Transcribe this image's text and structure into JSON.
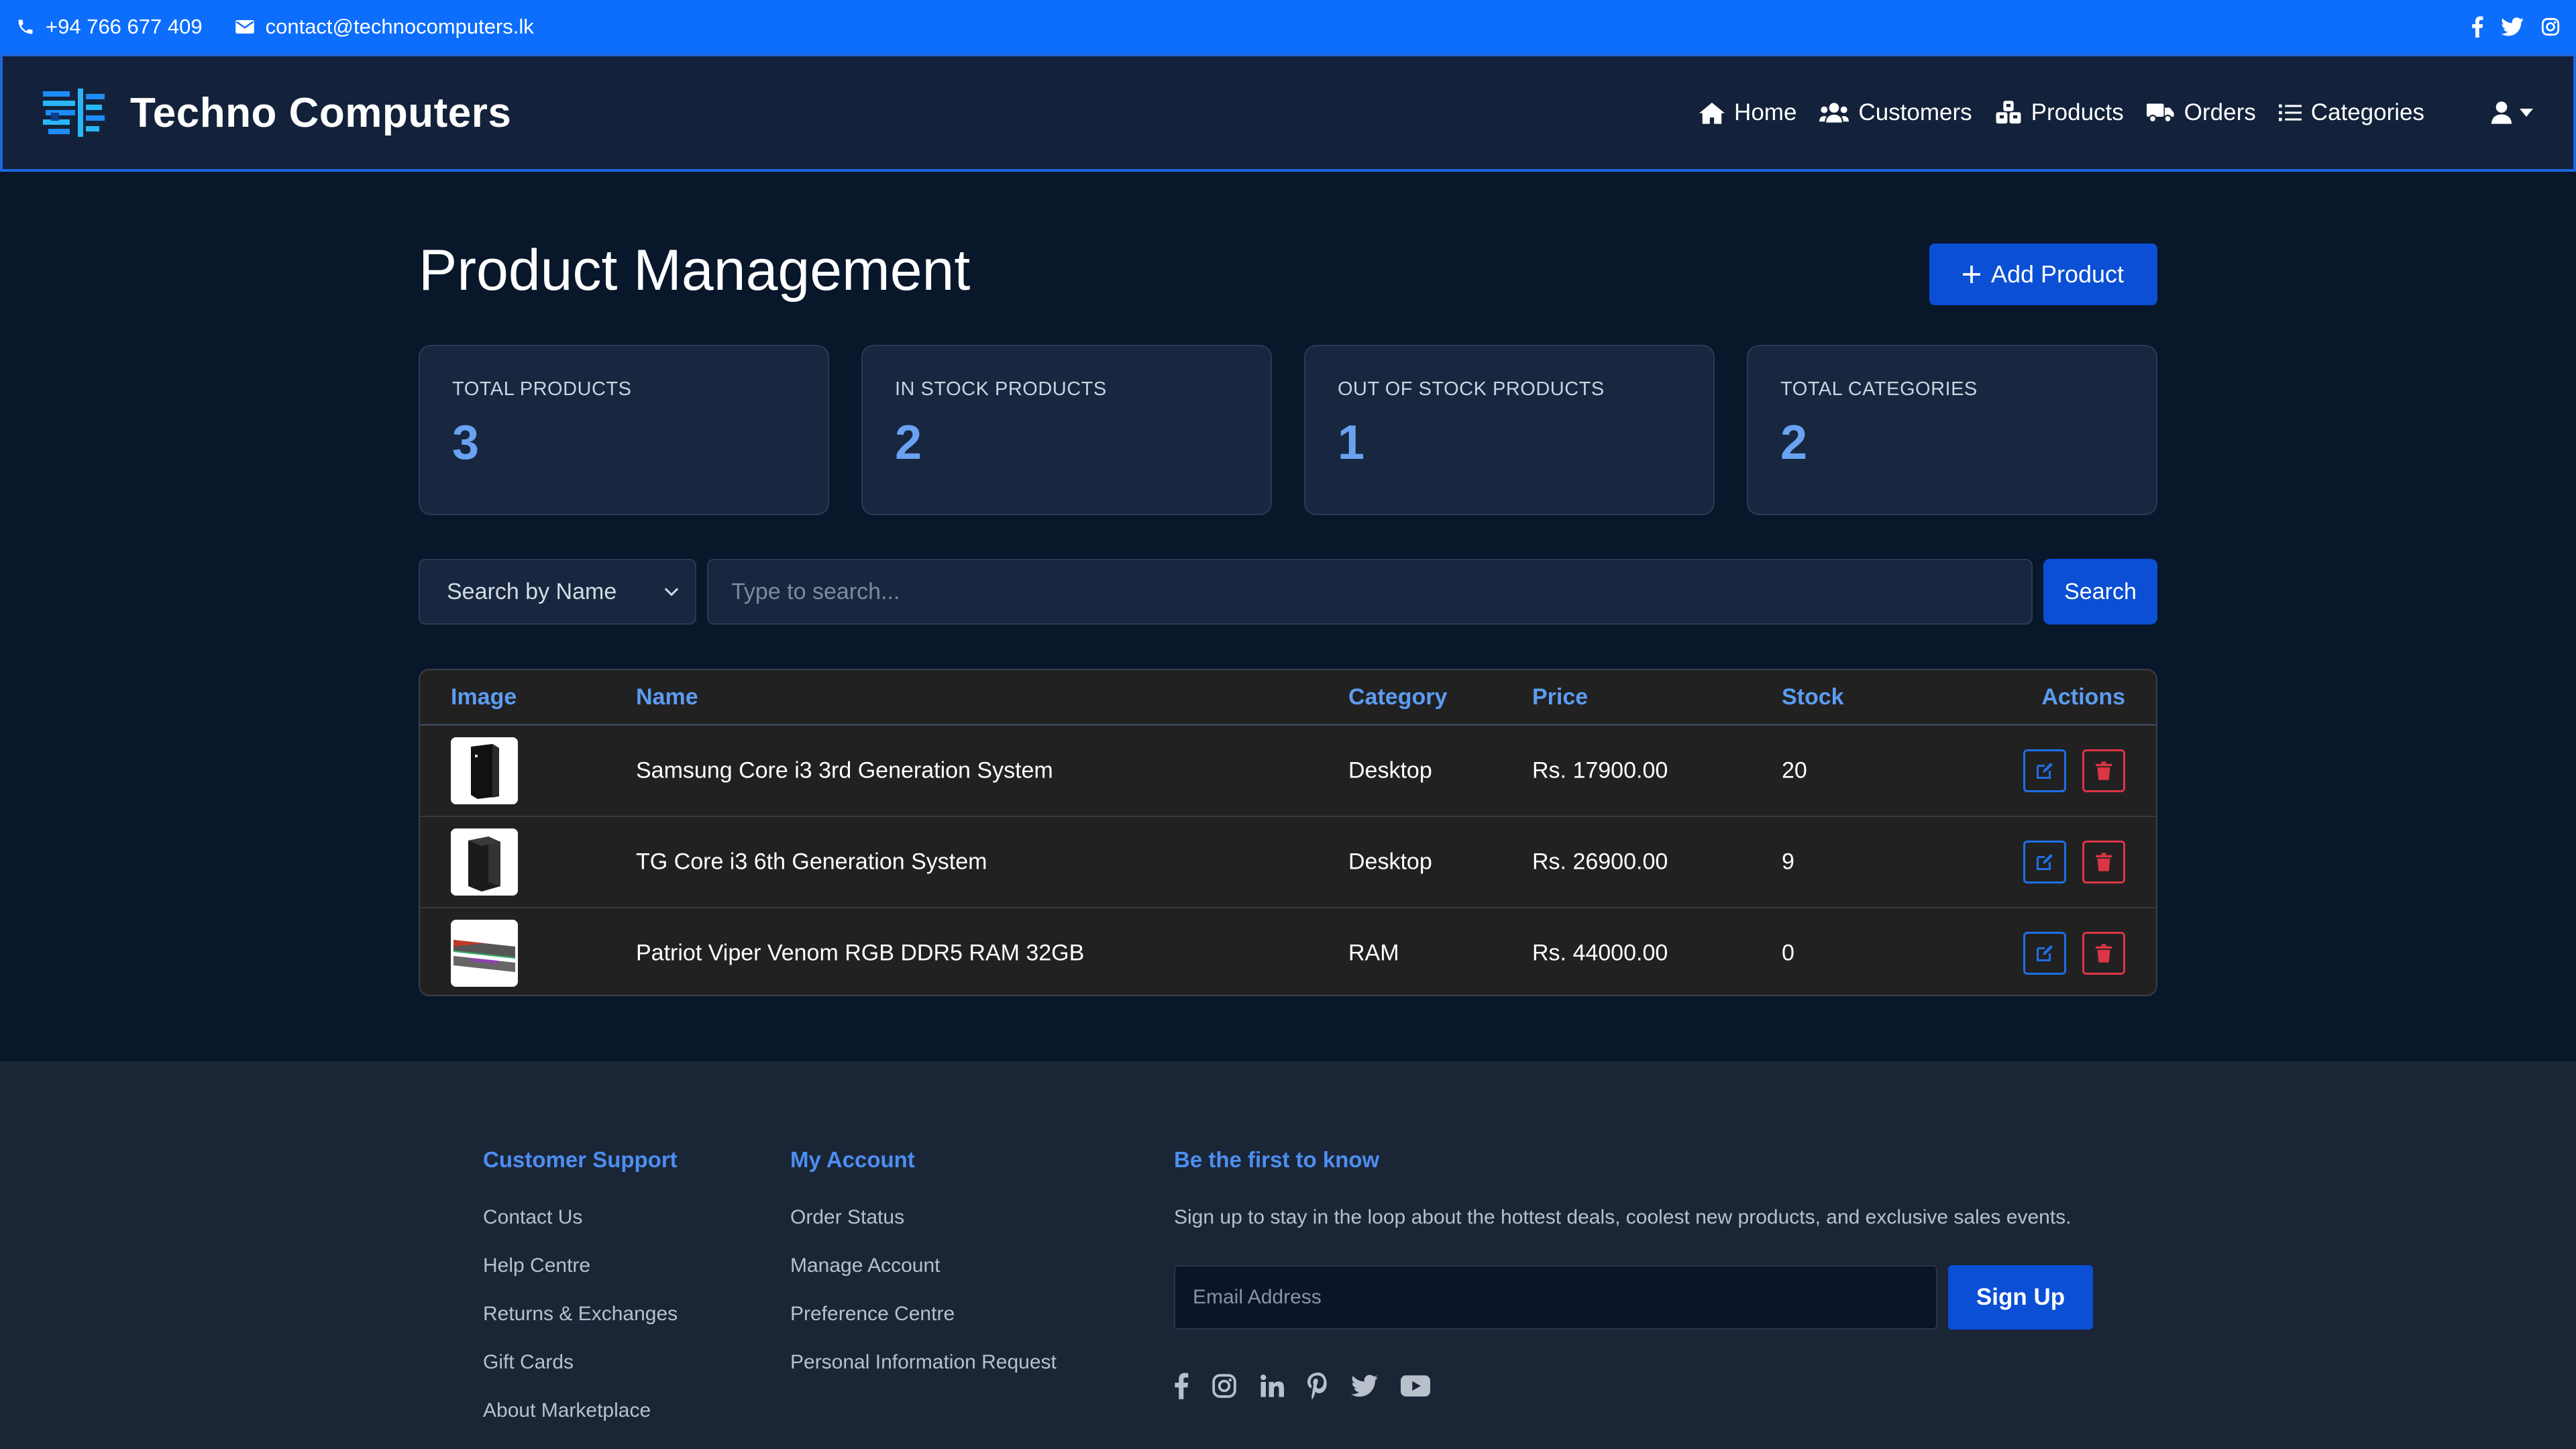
{
  "topbar": {
    "phone": "+94 766 677 409",
    "email": "contact@technocomputers.lk",
    "social_icons": [
      "facebook-icon",
      "twitter-icon",
      "instagram-icon"
    ]
  },
  "navbar": {
    "brand": "Techno Computers",
    "items": [
      {
        "label": "Home",
        "icon": "home-icon"
      },
      {
        "label": "Customers",
        "icon": "users-icon"
      },
      {
        "label": "Products",
        "icon": "cubes-icon"
      },
      {
        "label": "Orders",
        "icon": "truck-icon"
      },
      {
        "label": "Categories",
        "icon": "list-icon"
      }
    ],
    "user_icon": "user-icon"
  },
  "page": {
    "title": "Product Management",
    "add_button": "Add Product"
  },
  "stats": [
    {
      "label": "TOTAL PRODUCTS",
      "value": "3"
    },
    {
      "label": "IN STOCK PRODUCTS",
      "value": "2"
    },
    {
      "label": "OUT OF STOCK PRODUCTS",
      "value": "1"
    },
    {
      "label": "TOTAL CATEGORIES",
      "value": "2"
    }
  ],
  "search": {
    "filter_selected": "Search by Name",
    "placeholder": "Type to search...",
    "button": "Search"
  },
  "table": {
    "headers": {
      "image": "Image",
      "name": "Name",
      "category": "Category",
      "price": "Price",
      "stock": "Stock",
      "actions": "Actions"
    },
    "rows": [
      {
        "name": "Samsung Core i3 3rd Generation System",
        "category": "Desktop",
        "price": "Rs. 17900.00",
        "stock": "20"
      },
      {
        "name": "TG Core i3 6th Generation System",
        "category": "Desktop",
        "price": "Rs. 26900.00",
        "stock": "9"
      },
      {
        "name": "Patriot Viper Venom RGB DDR5 RAM 32GB",
        "category": "RAM",
        "price": "Rs. 44000.00",
        "stock": "0"
      }
    ]
  },
  "footer": {
    "support": {
      "heading": "Customer Support",
      "links": [
        "Contact Us",
        "Help Centre",
        "Returns & Exchanges",
        "Gift Cards",
        "About Marketplace"
      ]
    },
    "account": {
      "heading": "My Account",
      "links": [
        "Order Status",
        "Manage Account",
        "Preference Centre",
        "Personal Information Request"
      ]
    },
    "newsletter": {
      "heading": "Be the first to know",
      "description": "Sign up to stay in the loop about the hottest deals, coolest new products, and exclusive sales events.",
      "placeholder": "Email Address",
      "button": "Sign Up"
    },
    "social_icons": [
      "facebook-icon",
      "instagram-icon",
      "linkedin-icon",
      "pinterest-icon",
      "twitter-icon",
      "youtube-icon"
    ]
  },
  "colors": {
    "accent": "#0d6efd",
    "button": "#0b4fd4",
    "stat_value": "#6aa2f2",
    "delete": "#dc3545"
  }
}
